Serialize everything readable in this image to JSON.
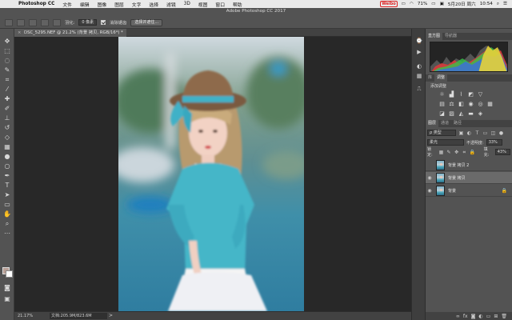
{
  "menubar": {
    "app": "Photoshop CC",
    "items": [
      "文件",
      "编辑",
      "图像",
      "图层",
      "文字",
      "选择",
      "滤镜",
      "3D",
      "视图",
      "窗口",
      "帮助"
    ],
    "battery": "71%",
    "clock": "5月20日 周六",
    "time": "10:54",
    "weibo": "Weibo"
  },
  "options": {
    "title": "Adobe Photoshop CC 2017",
    "feather_label": "羽化:",
    "feather_value": "0 像素",
    "antialias_label": "消除锯齿",
    "select_mask": "选择并遮住..."
  },
  "document": {
    "tab": "DSC_5295.NEF @ 21.2% (背景 拷贝, RGB/16*) *",
    "close": "×"
  },
  "status": {
    "zoom": "21.17%",
    "doc": "文档:205.9M/823.6M",
    "arrow": ">"
  },
  "panels": {
    "histogram_tabs": [
      "直方图",
      "导航器"
    ],
    "adjust_tabs": [
      "库",
      "调整"
    ],
    "adjust_title": "添加调整",
    "layers_tabs": [
      "图层",
      "通道",
      "路径"
    ],
    "filter_label": "ρ 类型",
    "blend_mode": "柔光",
    "opacity_label": "不透明度:",
    "opacity_value": "33%",
    "lock_label": "锁定:",
    "fill_label": "填充:",
    "fill_value": "43%",
    "layers": [
      {
        "name": "背景 拷贝 2",
        "visible": false,
        "selected": false
      },
      {
        "name": "背景 拷贝",
        "visible": true,
        "selected": true
      },
      {
        "name": "背景",
        "visible": true,
        "selected": false
      }
    ],
    "footer_icons": [
      "link-icon",
      "fx-icon",
      "mask-icon",
      "adjustment-icon",
      "folder-icon",
      "new-layer-icon",
      "trash-icon"
    ]
  },
  "colors": {
    "foreground": "#b8a096",
    "background": "#ffffff"
  }
}
